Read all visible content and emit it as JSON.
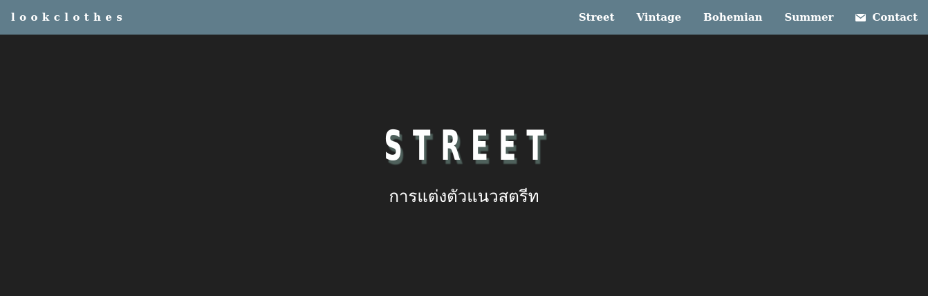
{
  "navbar": {
    "brand": "lookclothes",
    "links": [
      {
        "label": "Street"
      },
      {
        "label": "Vintage"
      },
      {
        "label": "Bohemian"
      },
      {
        "label": "Summer"
      },
      {
        "label": "Contact",
        "icon": "envelope-icon"
      }
    ]
  },
  "hero": {
    "title": "STREET",
    "subtitle": "การแต่งตัวแนวสตรีท"
  },
  "colors": {
    "navbar_bg": "#607d8b",
    "page_bg": "#212121",
    "text": "#ffffff",
    "title_shadow": "#4f615c"
  }
}
